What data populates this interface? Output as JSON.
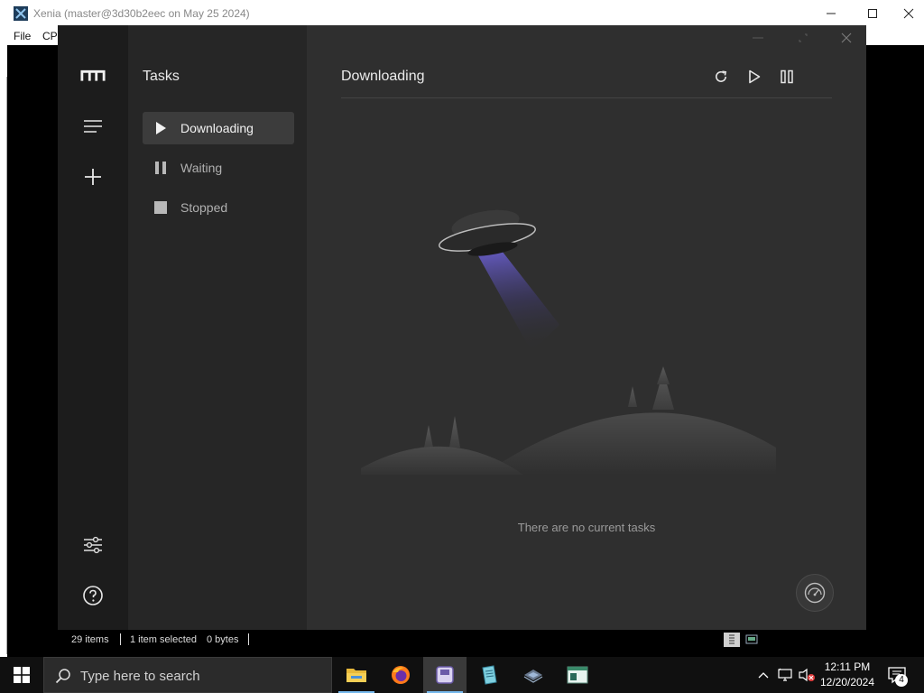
{
  "xenia": {
    "title": "Xenia (master@3d30b2eec on May 25 2024)",
    "menu": [
      "File",
      "CP"
    ],
    "status": {
      "items": "29 items",
      "selected": "1 item selected",
      "size": "0 bytes"
    }
  },
  "motrix": {
    "rail": {
      "logo_icon": "motrix-logo-icon",
      "menu_icon": "hamburger-menu-icon",
      "add_icon": "plus-icon",
      "preferences_icon": "sliders-icon",
      "help_icon": "question-circle-icon"
    },
    "subnav": {
      "title": "Tasks",
      "items": [
        {
          "label": "Downloading",
          "icon": "play-icon",
          "active": true
        },
        {
          "label": "Waiting",
          "icon": "pause-icon",
          "active": false
        },
        {
          "label": "Stopped",
          "icon": "stop-icon",
          "active": false
        }
      ]
    },
    "main": {
      "title": "Downloading",
      "toolbar": [
        "refresh-icon",
        "resume-all-icon",
        "pause-all-icon"
      ],
      "empty_text": "There are no current tasks"
    },
    "colors": {
      "rail_bg": "#1c1c1c",
      "subnav_bg": "#262626",
      "main_bg": "#2f2f2f",
      "active_item_bg": "#3c3c3c",
      "ufo_beam": "#6a5acd"
    }
  },
  "taskbar": {
    "search_placeholder": "Type here to search",
    "apps": [
      "file-explorer-icon",
      "firefox-icon",
      "app-icon",
      "notepad-icon",
      "stack-icon",
      "window-icon"
    ],
    "clock": {
      "time": "12:11 PM",
      "date": "12/20/2024"
    },
    "notifications": "4"
  }
}
